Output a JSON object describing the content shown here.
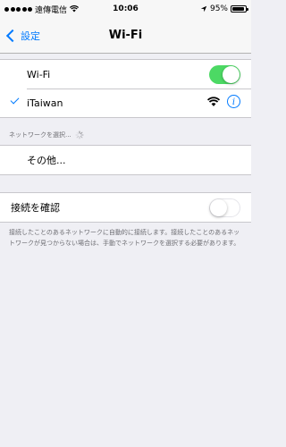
{
  "status_bar": {
    "carrier": "遠傳電信",
    "time": "10:06",
    "battery": "95%",
    "battery_level": 0.95
  },
  "nav": {
    "back_label": "設定",
    "title": "Wi-Fi"
  },
  "wifi_toggle": {
    "label": "Wi-Fi",
    "on": true
  },
  "connected_network": {
    "name": "iTaiwan",
    "info_glyph": "i"
  },
  "choose_network": {
    "header": "ネットワークを選択...",
    "other_label": "その他..."
  },
  "ask_to_join": {
    "label": "接続を確認",
    "on": false,
    "footer": "接続したことのあるネットワークに自動的に接続します。接続したことのあるネットワークが見つからない場合は、手動でネットワークを選択する必要があります。"
  },
  "colors": {
    "accent": "#007aff",
    "toggle_on": "#4cd964",
    "background": "#efeff4"
  }
}
